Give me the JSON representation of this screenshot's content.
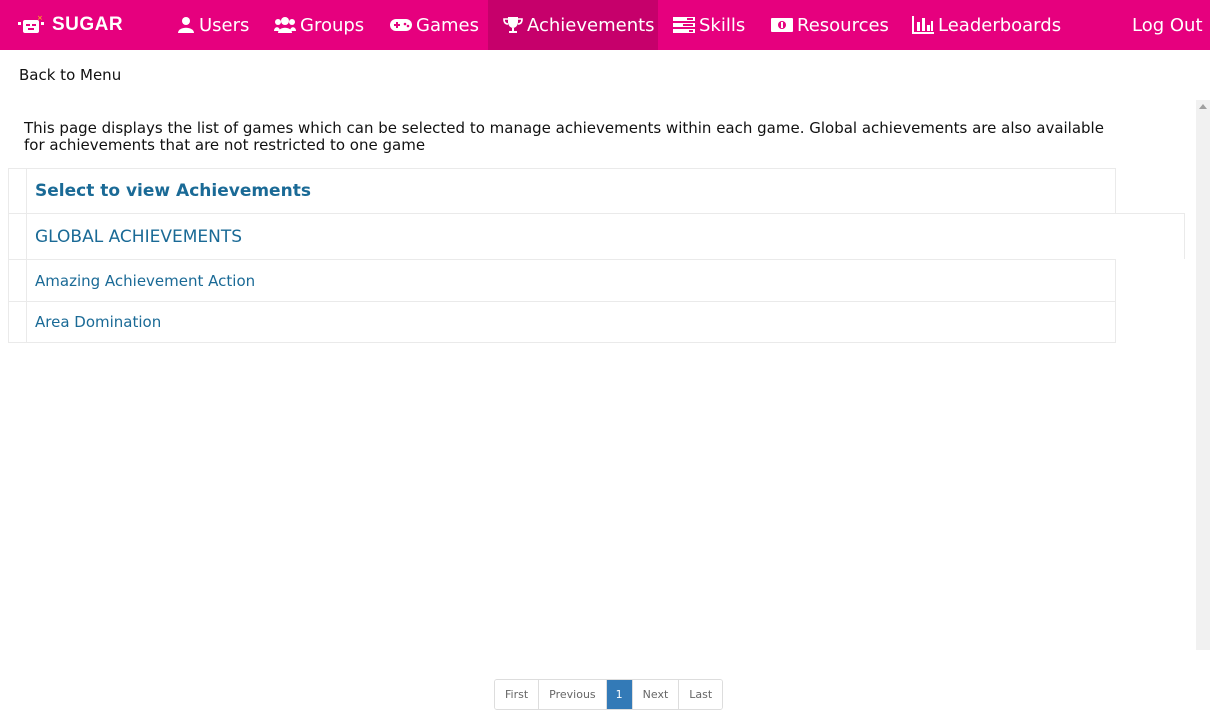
{
  "app": {
    "name": "SUGAR"
  },
  "nav": {
    "items": [
      {
        "label": "Users",
        "icon": "user-icon"
      },
      {
        "label": "Groups",
        "icon": "group-icon"
      },
      {
        "label": "Games",
        "icon": "gamepad-icon"
      },
      {
        "label": "Achievements",
        "icon": "trophy-icon",
        "active": true
      },
      {
        "label": "Skills",
        "icon": "skills-icon"
      },
      {
        "label": "Resources",
        "icon": "money-icon"
      },
      {
        "label": "Leaderboards",
        "icon": "bar-chart-icon"
      }
    ],
    "logout": "Log Out"
  },
  "page": {
    "back_link": "Back to Menu",
    "description": "This page displays the list of games which can be selected to manage achievements within each game. Global achievements are also available for achievements that are not restricted to one game"
  },
  "table": {
    "header": "Select to view Achievements",
    "global": "GLOBAL ACHIEVEMENTS",
    "rows": [
      "Amazing Achievement Action",
      "Area Domination"
    ]
  },
  "pagination": {
    "first": "First",
    "previous": "Previous",
    "current": "1",
    "next": "Next",
    "last": "Last"
  },
  "colors": {
    "brand": "#e6007e",
    "active_nav": "#c6006b",
    "link": "#1a6a96",
    "page_active": "#337ab7"
  }
}
